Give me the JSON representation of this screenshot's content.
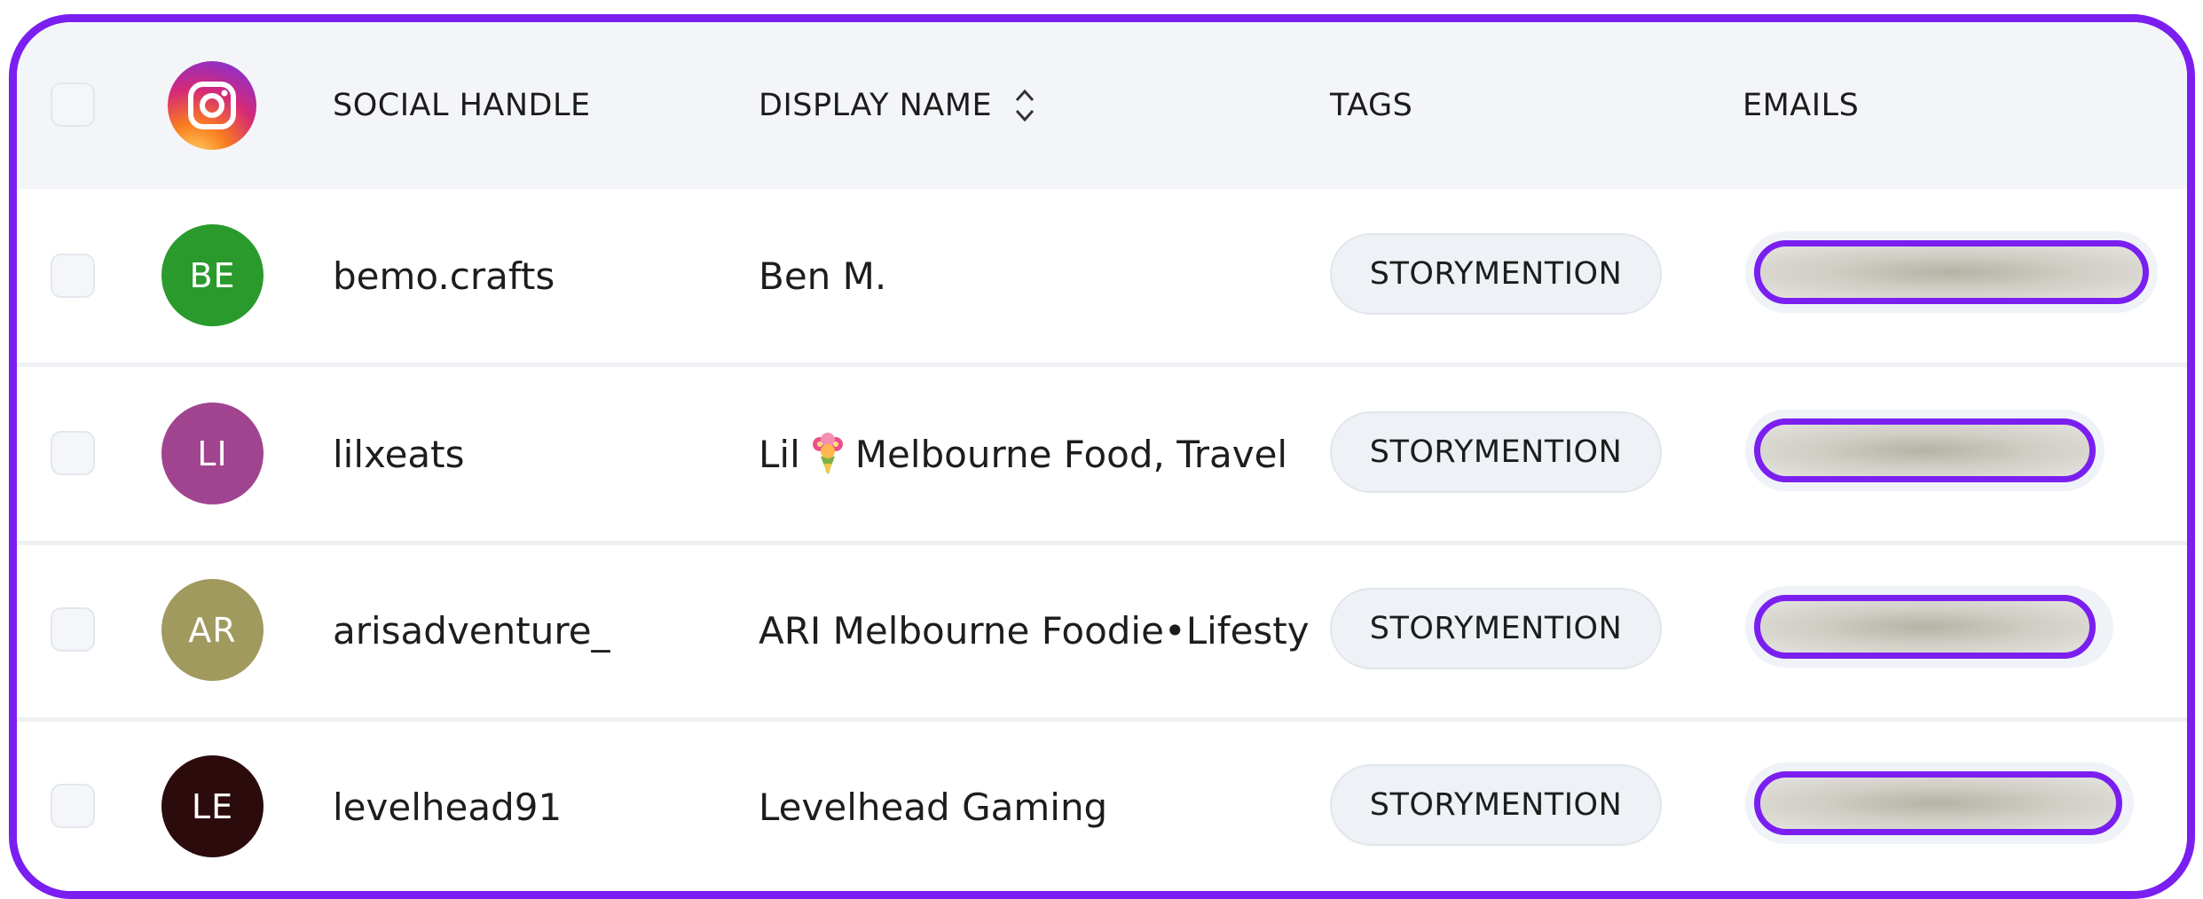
{
  "header": {
    "social_handle": "SOCIAL HANDLE",
    "display_name": "DISPLAY NAME",
    "tags": "TAGS",
    "emails": "EMAILS",
    "platform_icon": "instagram-icon",
    "sort_icon": "sort-updown-icon"
  },
  "rows": [
    {
      "initials": "BE",
      "avatar_color": "#2a9a2d",
      "handle": "bemo.crafts",
      "display_name": "Ben M.",
      "tag": "STORYMENTION"
    },
    {
      "initials": "LI",
      "avatar_color": "#a0448f",
      "handle": "lilxeats",
      "display_name_pre": "Lil",
      "display_name_post": "Melbourne Food, Travel",
      "tag": "STORYMENTION"
    },
    {
      "initials": "AR",
      "avatar_color": "#a09a5e",
      "handle": "arisadventure_",
      "display_name": "ARI Melbourne Foodie•Lifestyle",
      "tag": "STORYMENTION"
    },
    {
      "initials": "LE",
      "avatar_color": "#2c0b0c",
      "handle": "levelhead91",
      "display_name": "Levelhead Gaming",
      "tag": "STORYMENTION"
    }
  ],
  "accent_color": "#7a1ff0"
}
